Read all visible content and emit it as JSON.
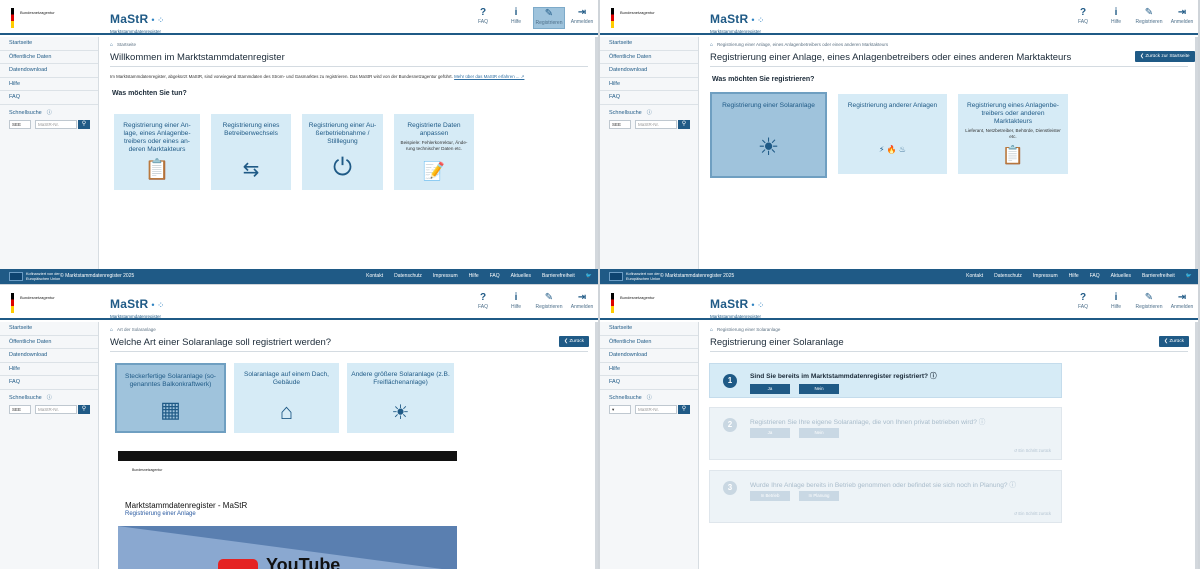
{
  "header": {
    "org": "Bundesnetzagentur",
    "logo_name": "MaStR",
    "logo_dots": "• ⁘",
    "logo_sub": "Marktstammdatenregister",
    "nav": [
      {
        "label": "FAQ",
        "icon": "?"
      },
      {
        "label": "Hilfe",
        "icon": "i"
      },
      {
        "label": "Registrieren",
        "icon": "✎"
      },
      {
        "label": "Anmelden",
        "icon": "⇥"
      }
    ]
  },
  "sidebar": {
    "items": [
      "Startseite",
      "Öffentliche Daten",
      "Datendownload",
      "Hilfe",
      "FAQ"
    ],
    "quicksearch_label": "Schnellsuche",
    "quicksearch_info": "ⓘ",
    "select_value": "SEE",
    "input_placeholder": "MaStR-Nr.",
    "search_icon": "⚲"
  },
  "panel1": {
    "breadcrumb": "Startseite",
    "title": "Willkommen im Marktstammdatenregister",
    "intro": "Im Marktstammdatenregister, abgekürzt MaStR, sind vorwiegend Stammdaten des Strom- und Gasmarktes zu registrieren. Das MaStR wird von der Bundesnetzagentur geführt.",
    "intro_link": "Mehr über das MaStR erfahren ... ↗",
    "question": "Was möchten Sie tun?",
    "cards": [
      {
        "title": "Registrierung einer An-lage, eines Anlagenbe-treibers oder eines an-deren Marktakteurs",
        "sub": "",
        "icon": "📋"
      },
      {
        "title": "Registrierung eines Betreiberwechsels",
        "sub": "",
        "icon": "⇆"
      },
      {
        "title": "Registrierung einer Au-ßerbetriebnahme / Stilllegung",
        "sub": "",
        "icon": "⏻"
      },
      {
        "title": "Registrierte Daten anpassen",
        "sub": "Beispiele: Fehlerkorrektur, Ände-rung technischer Daten etc.",
        "icon": "📝"
      }
    ]
  },
  "panel2": {
    "breadcrumb": "Registrierung einer Anlage, eines Anlagenbetreibers oder eines anderen Marktakteurs",
    "title": "Registrierung einer Anlage, eines Anlagenbetreibers oder eines anderen Marktakteurs",
    "back_label": "❮ Zurück zur Startseite",
    "question": "Was möchten Sie registrieren?",
    "cards": [
      {
        "title": "Registrierung einer Solaranlage",
        "sub": "",
        "icon": "☀"
      },
      {
        "title": "Registrierung anderer Anlagen",
        "sub": "",
        "icon": "⚡ 🔥 ♨"
      },
      {
        "title": "Registrierung eines Anlagenbe-treibers oder anderen Marktakteurs",
        "sub": "Lieferant, Netzbetreiber, Behörde, Dienstleister etc.",
        "icon": "📋"
      }
    ]
  },
  "panel3": {
    "breadcrumb": "Art der Solaranlage",
    "title": "Welche Art einer Solaranlage soll registriert werden?",
    "back_label": "❮ Zurück",
    "cards": [
      {
        "title": "Steckerfertige Solaranlage (so-genanntes Balkonkraftwerk)",
        "icon": "▦"
      },
      {
        "title": "Solaranlage auf einem Dach, Gebäude",
        "icon": "⌂"
      },
      {
        "title": "Andere größere Solaranlage (z.B. Freiflächenanlage)",
        "icon": "☀"
      }
    ],
    "video": {
      "org": "Bundesnetzagentur",
      "title": "Marktstammdatenregister - MaStR",
      "subtitle": "Registrierung einer Anlage",
      "yt": "YouTube"
    }
  },
  "panel4": {
    "breadcrumb": "Registrierung einer Solaranlage",
    "title": "Registrierung einer Solaranlage",
    "back_label": "❮ Zurück",
    "steps": [
      {
        "num": "1",
        "question": "Sind Sie bereits im Marktstammdatenregister registriert?",
        "info": "ⓘ",
        "buttons": [
          "Ja",
          "Nein"
        ],
        "back": ""
      },
      {
        "num": "2",
        "question": "Registrieren Sie Ihre eigene Solaranlage, die von Ihnen privat betrieben wird?",
        "info": "ⓘ",
        "buttons": [
          "Ja",
          "Nein"
        ],
        "back": "↺ Ein Schritt zurück"
      },
      {
        "num": "3",
        "question": "Wurde Ihre Anlage bereits in Betrieb genommen oder befindet sie sich noch in Planung?",
        "info": "ⓘ",
        "buttons": [
          "In Betrieb",
          "In Planung"
        ],
        "back": "↺ Ein Schritt zurück"
      }
    ]
  },
  "footer": {
    "eu_text": "Kofinanziert von der Europäischen Union",
    "copyright": "© Marktstammdatenregister 2025",
    "links": [
      "Kontakt",
      "Datenschutz",
      "Impressum",
      "Hilfe",
      "FAQ",
      "Aktuelles",
      "Barrierefreiheit",
      "🐦"
    ]
  },
  "colors": {
    "primary": "#1f5a86",
    "card": "#d6ebf6",
    "card_selected": "#9fc3dc"
  }
}
